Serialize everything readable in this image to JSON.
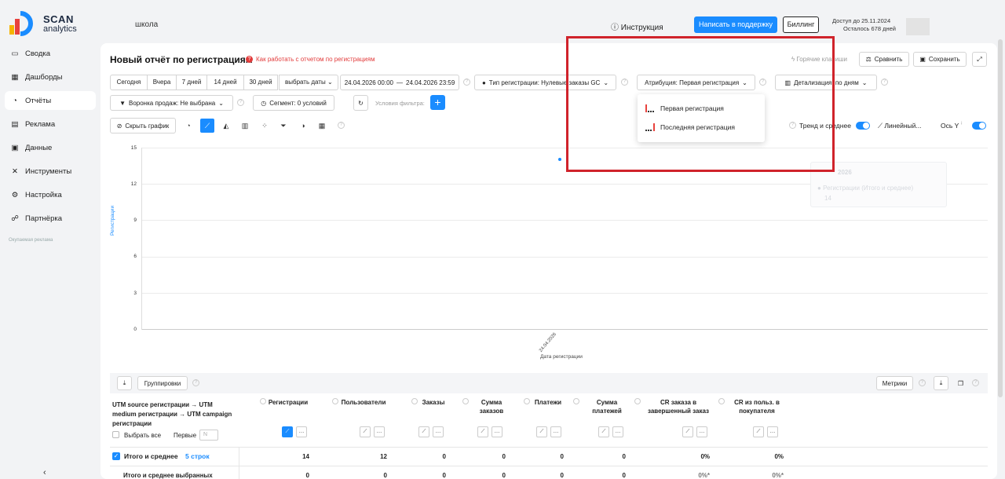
{
  "app": {
    "logo_line1": "SCAN",
    "logo_line2": "analytics",
    "crumb": "школа"
  },
  "header": {
    "instruction_label": "Инструкция",
    "support_label": "Написать в поддержку",
    "billing_label": "Биллинг",
    "access_line1": "Доступ до 25.11.2024",
    "access_line2": "Осталось 678 дней"
  },
  "sidebar": {
    "items": [
      {
        "label": "Сводка",
        "icon": "summary-icon"
      },
      {
        "label": "Дашборды",
        "icon": "dashboard-icon"
      },
      {
        "label": "Отчёты",
        "icon": "reports-icon",
        "active": true
      },
      {
        "label": "Реклама",
        "icon": "ads-icon"
      },
      {
        "label": "Данные",
        "icon": "database-icon"
      },
      {
        "label": "Инструменты",
        "icon": "tools-icon"
      },
      {
        "label": "Настройка",
        "icon": "settings-icon"
      },
      {
        "label": "Партнёрка",
        "icon": "partner-icon"
      }
    ],
    "small_text": "Окупаемая реклама",
    "collapse_icon": "‹"
  },
  "report": {
    "title": "Новый отчёт по регистрациям",
    "howto_label": "Как работать с отчетом по регистрациям",
    "hotkeys_label": "Горячие клавиши",
    "compare_label": "Сравнить",
    "save_label": "Сохранить"
  },
  "filters": {
    "periods": [
      "Сегодня",
      "Вчера",
      "7 дней",
      "14 дней",
      "30 дней"
    ],
    "pick_dates": "выбрать даты",
    "date_from": "24.04.2026 00:00",
    "date_sep": "—",
    "date_to": "24.04.2026 23:59",
    "reg_type": "Тип регистрации: Нулевые заказы GC",
    "attribution": "Атрибуция: Первая регистрация",
    "detail": "Детализация: по дням",
    "funnel": "Воронка продаж: Не выбрана",
    "segment": "Сегмент: 0 условий",
    "filter_conditions": "Условия фильтра:"
  },
  "attribution_dropdown": {
    "options": [
      "Первая регистрация",
      "Последняя регистрация"
    ]
  },
  "chart_toolbar": {
    "hide_chart": "Скрыть график",
    "trend_label": "Тренд и среднее",
    "linear_label": "Линейный...",
    "yaxis_label": "Ось Y"
  },
  "chart_data": {
    "type": "line",
    "x": [
      "24.04.2026"
    ],
    "series": [
      {
        "values": [
          14
        ]
      }
    ],
    "ylabel": "Регистрации",
    "xlabel": "Дата регистрации",
    "ylim": [
      0,
      15
    ],
    "yticks": [
      "15",
      "12",
      "9",
      "6",
      "3",
      "0"
    ],
    "grid": true
  },
  "legend_ghost": {
    "line1": "2026",
    "line2": "Регистрации (Итого и среднее)",
    "line3": "14"
  },
  "table": {
    "groupings_label": "Группировки",
    "metrics_label": "Метрики",
    "group_header": "UTM source регистрации → UTM medium регистрации → UTM campaign регистрации",
    "select_all": "Выбрать все",
    "first_label": "Первые",
    "first_value": "N",
    "columns": [
      "Регистрации",
      "Пользователи",
      "Заказы",
      "Сумма заказов",
      "Платежи",
      "Сумма платежей",
      "CR заказа в завершенный заказ",
      "CR из польз. в покупателя"
    ],
    "totals": {
      "label": "Итого и среднее",
      "rows_count": "5 строк",
      "values": [
        "14",
        "12",
        "0",
        "0",
        "0",
        "0",
        "0%",
        "0%"
      ]
    },
    "selected": {
      "label": "Итого и среднее выбранных",
      "values": [
        "0",
        "0",
        "0",
        "0",
        "0",
        "0",
        "0%*",
        "0%*"
      ]
    }
  }
}
